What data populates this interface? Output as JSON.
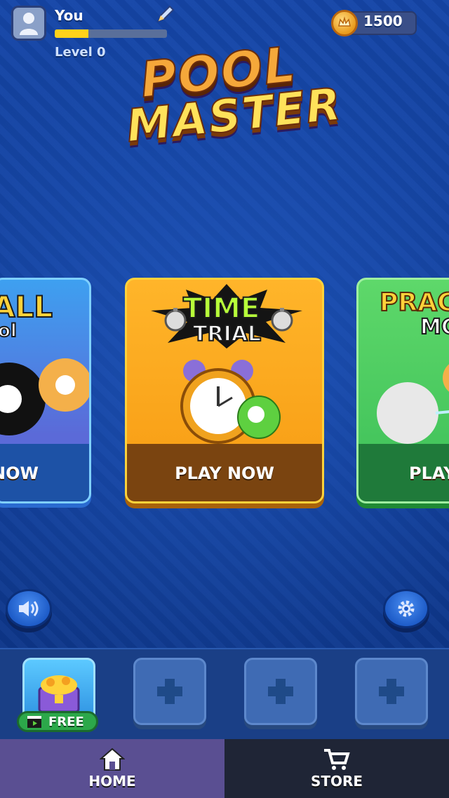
{
  "player": {
    "name": "You",
    "level_label": "Level 0",
    "xp_progress": 0.3
  },
  "currency": {
    "coins": "1500",
    "icon": "coin-crown-icon"
  },
  "logo": {
    "line1": "POOL",
    "line2": "MASTER"
  },
  "modes": [
    {
      "title_line1": "ALL",
      "title_line2": "ol",
      "play_label": "NOW",
      "color": "#3ea0f0"
    },
    {
      "title_line1": "TIME",
      "title_line2": "TRIAL",
      "play_label": "PLAY NOW",
      "color": "#f79b12"
    },
    {
      "title_line1": "PRAC",
      "title_line2": "MC",
      "play_label": "PLAY",
      "color": "#3cbf58"
    }
  ],
  "controls": {
    "sound_icon": "speaker-icon",
    "settings_icon": "gear-icon"
  },
  "tray": {
    "free_label": "FREE",
    "slot_icon": "plus-icon"
  },
  "nav": {
    "home_label": "HOME",
    "store_label": "STORE"
  }
}
